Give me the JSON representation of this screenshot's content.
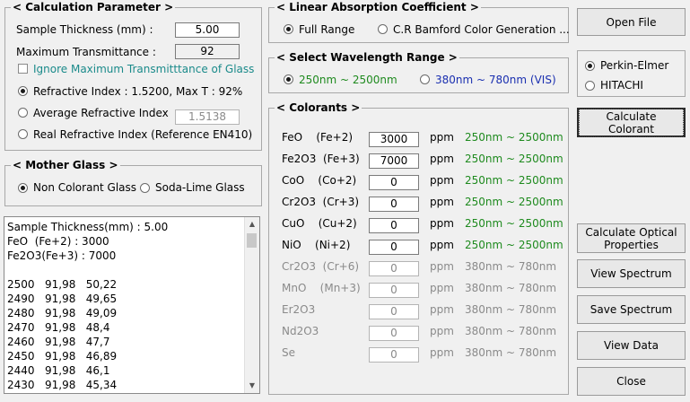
{
  "calc": {
    "title": "< Calculation Parameter >",
    "thickness_label": "Sample Thickness (mm) :",
    "thickness_value": "5.00",
    "max_trans_label": "Maximum Transmittance :",
    "max_trans_value": "92",
    "ignore_label": "Ignore Maximum Transmitttance of Glass",
    "ri1_label": "Refractive Index : 1.5200,  Max T : 92%",
    "ri2_label": "Average Refractive Index",
    "ri2_value": "1.5138",
    "ri3_label": "Real Refractive Index (Reference EN410)"
  },
  "mother": {
    "title": "< Mother Glass >",
    "opt1": "Non Colorant Glass",
    "opt2": "Soda-Lime Glass"
  },
  "output": {
    "lines": [
      "Sample Thickness(mm) : 5.00",
      "FeO  (Fe+2) : 3000",
      "Fe2O3(Fe+3) : 7000",
      "",
      "2500   91,98   50,22",
      "2490   91,98   49,65",
      "2480   91,98   49,09",
      "2470   91,98   48,4",
      "2460   91,98   47,7",
      "2450   91,98   46,89",
      "2440   91,98   46,1",
      "2430   91,98   45,34"
    ]
  },
  "lac": {
    "title": "< Linear Absorption Coefficient >",
    "opt1": "Full Range",
    "opt2": "C.R Bamford Color Generation ..."
  },
  "wave": {
    "title": "< Select Wavelength Range >",
    "opt1": "250nm ~ 2500nm",
    "opt2": "380nm ~ 780nm (VIS)"
  },
  "colorants": {
    "title": "< Colorants >",
    "unit": "ppm",
    "rows": [
      {
        "name": "FeO    (Fe+2)",
        "value": "3000",
        "range": "250nm ~ 2500nm"
      },
      {
        "name": "Fe2O3  (Fe+3)",
        "value": "7000",
        "range": "250nm ~ 2500nm"
      },
      {
        "name": "CoO    (Co+2)",
        "value": "0",
        "range": "250nm ~ 2500nm"
      },
      {
        "name": "Cr2O3  (Cr+3)",
        "value": "0",
        "range": "250nm ~ 2500nm"
      },
      {
        "name": "CuO    (Cu+2)",
        "value": "0",
        "range": "250nm ~ 2500nm"
      },
      {
        "name": "NiO    (Ni+2)",
        "value": "0",
        "range": "250nm ~ 2500nm"
      },
      {
        "name": "Cr2O3  (Cr+6)",
        "value": "0",
        "range": "380nm ~ 780nm"
      },
      {
        "name": "MnO    (Mn+3)",
        "value": "0",
        "range": "380nm ~ 780nm"
      },
      {
        "name": "Er2O3",
        "value": "0",
        "range": "380nm ~ 780nm"
      },
      {
        "name": "Nd2O3",
        "value": "0",
        "range": "380nm ~ 780nm"
      },
      {
        "name": "Se",
        "value": "0",
        "range": "380nm ~ 780nm"
      }
    ]
  },
  "buttons": {
    "open_file": "Open File",
    "calc_colorant": "Calculate Colorant",
    "calc_optical": "Calculate Optical Properties",
    "view_spectrum": "View Spectrum",
    "save_spectrum": "Save Spectrum",
    "view_data": "View Data",
    "close": "Close"
  },
  "instrument": {
    "opt1": "Perkin-Elmer",
    "opt2": "HITACHI"
  }
}
